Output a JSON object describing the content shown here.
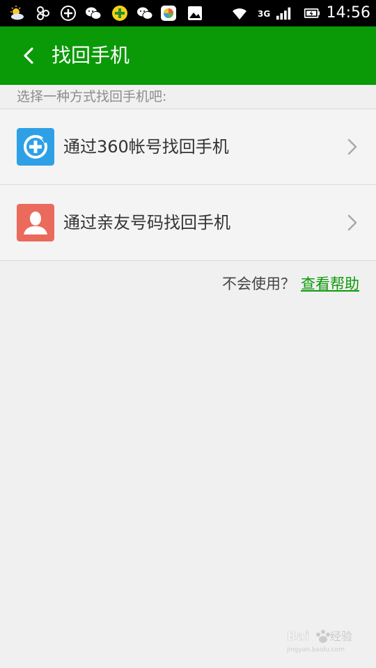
{
  "status_bar": {
    "time": "14:56",
    "network": "3G",
    "icons": [
      "weather-icon",
      "cluster-icon",
      "plus-circle-icon",
      "wechat-icon",
      "game-icon",
      "wechat-icon",
      "app-store-icon",
      "gallery-icon",
      "wifi-icon",
      "signal-icon",
      "battery-icon"
    ]
  },
  "header": {
    "title": "找回手机",
    "background_color": "#0a9a07"
  },
  "content": {
    "hint": "选择一种方式找回手机吧:",
    "options": [
      {
        "label": "通过360帐号找回手机",
        "icon": "360-shield-icon",
        "icon_color": "#2ea0e6"
      },
      {
        "label": "通过亲友号码找回手机",
        "icon": "contact-person-icon",
        "icon_color": "#ea6a5c"
      }
    ],
    "help_prompt": "不会使用？",
    "help_link": "查看帮助"
  },
  "watermark": {
    "text": "Baidu经验",
    "subtext": "jingyan.baidu.com"
  }
}
